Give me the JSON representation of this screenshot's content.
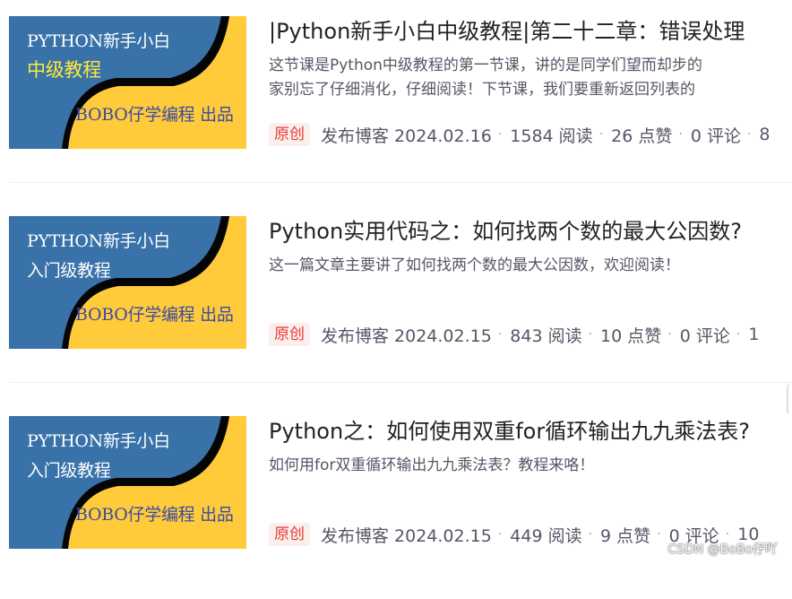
{
  "articles": [
    {
      "thumb": {
        "line1": "PYTHON新手小白",
        "line2": "中级教程",
        "line3": "BOBO仔学编程 出品"
      },
      "title": "|Python新手小白中级教程|第二十二章：错误处理",
      "desc": [
        "这节课是Python中级教程的第一节课，讲的是同学们望而却步的",
        "家别忘了仔细消化，仔细阅读！下节课，我们要重新返回列表的"
      ],
      "badge": "原创",
      "published": "发布博客 2024.02.16",
      "reads": "1584 阅读",
      "likes": "26 点赞",
      "comments": "0 评论",
      "extra": "8"
    },
    {
      "thumb": {
        "line1": "PYTHON新手小白",
        "line2": "入门级教程",
        "line3": "BOBO仔学编程 出品"
      },
      "title": "Python实用代码之：如何找两个数的最大公因数?",
      "desc": [
        "这一篇文章主要讲了如何找两个数的最大公因数，欢迎阅读！"
      ],
      "badge": "原创",
      "published": "发布博客 2024.02.15",
      "reads": "843 阅读",
      "likes": "10 点赞",
      "comments": "0 评论",
      "extra": "1"
    },
    {
      "thumb": {
        "line1": "PYTHON新手小白",
        "line2": "入门级教程",
        "line3": "BOBO仔学编程 出品"
      },
      "title": "Python之：如何使用双重for循环输出九九乘法表?",
      "desc": [
        "如何用for双重循环输出九九乘法表？教程来咯！"
      ],
      "badge": "原创",
      "published": "发布博客 2024.02.15",
      "reads": "449 阅读",
      "likes": "9 点赞",
      "comments": "0 评论",
      "extra": "10"
    }
  ],
  "meta_separator": "·",
  "watermark": "CSDN @BoBo仔吖",
  "colors": {
    "thumb_blue": "#3872a8",
    "thumb_yellow": "#ffcb3a",
    "badge_bg": "#fdeeee",
    "badge_text": "#e33e33"
  }
}
